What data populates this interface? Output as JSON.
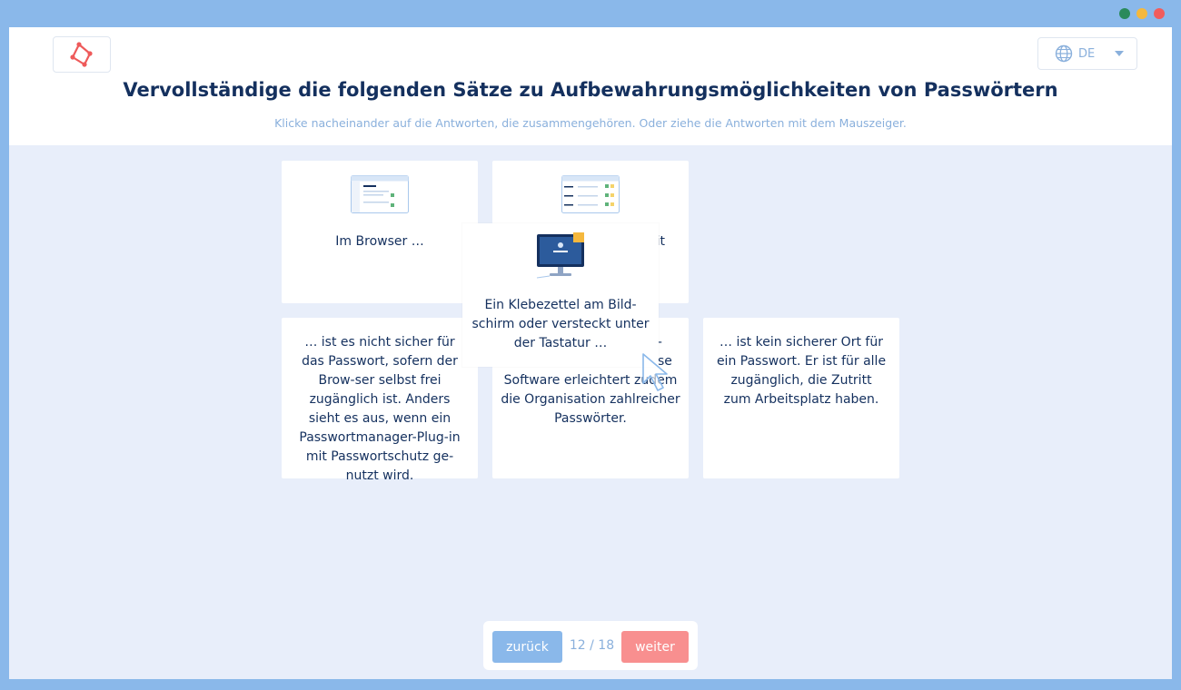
{
  "window": {
    "controls": [
      {
        "name": "green-dot",
        "color": "#2a8a5c"
      },
      {
        "name": "yellow-dot",
        "color": "#f5b83d"
      },
      {
        "name": "red-dot",
        "color": "#f25c5c"
      }
    ]
  },
  "header": {
    "language": "DE",
    "title": "Vervollständige die folgenden Sätze zu Aufbewahrungsmöglichkeiten von Passwörtern",
    "subtitle": "Klicke nacheinander auf die Antworten, die zusammengehören. Oder ziehe die Antworten mit dem Mauszeiger."
  },
  "cards_top": [
    {
      "text": "Im Browser …",
      "icon": "browser-window-thumbnail"
    },
    {
      "text": "it",
      "icon": "password-manager-thumbnail"
    }
  ],
  "cards_bottom": [
    {
      "text": "… ist es nicht sicher für das Passwort, sofern der Brow-ser selbst frei zugänglich ist. Anders sieht es aus, wenn ein Passwortmanager-Plug-in mit Passwortschutz ge-nutzt wird."
    },
    {
      "text": "i- se Software erleichtert zu…n die Organisation zahlreicher Passwörter.",
      "line1": "i-",
      "line2": "se",
      "line3": "Software erleichtert zudem",
      "line4": "die Organisation zahlreicher",
      "line5": "Passwörter."
    },
    {
      "text": "… ist kein sicherer Ort für ein Passwort. Er ist für alle zugänglich, die Zutritt zum Arbeitsplatz haben."
    }
  ],
  "drag_card": {
    "text": "Ein Klebezettel am Bild-schirm oder versteckt unter der Tastatur …",
    "icon": "monitor-sticky-note-thumbnail"
  },
  "nav": {
    "back": "zurück",
    "counter": "12 / 18",
    "next": "weiter"
  },
  "colors": {
    "frame": "#8ab8ea",
    "accent_red": "#f88f8f",
    "text_dark": "#14305e",
    "text_light": "#8ab0dc"
  }
}
